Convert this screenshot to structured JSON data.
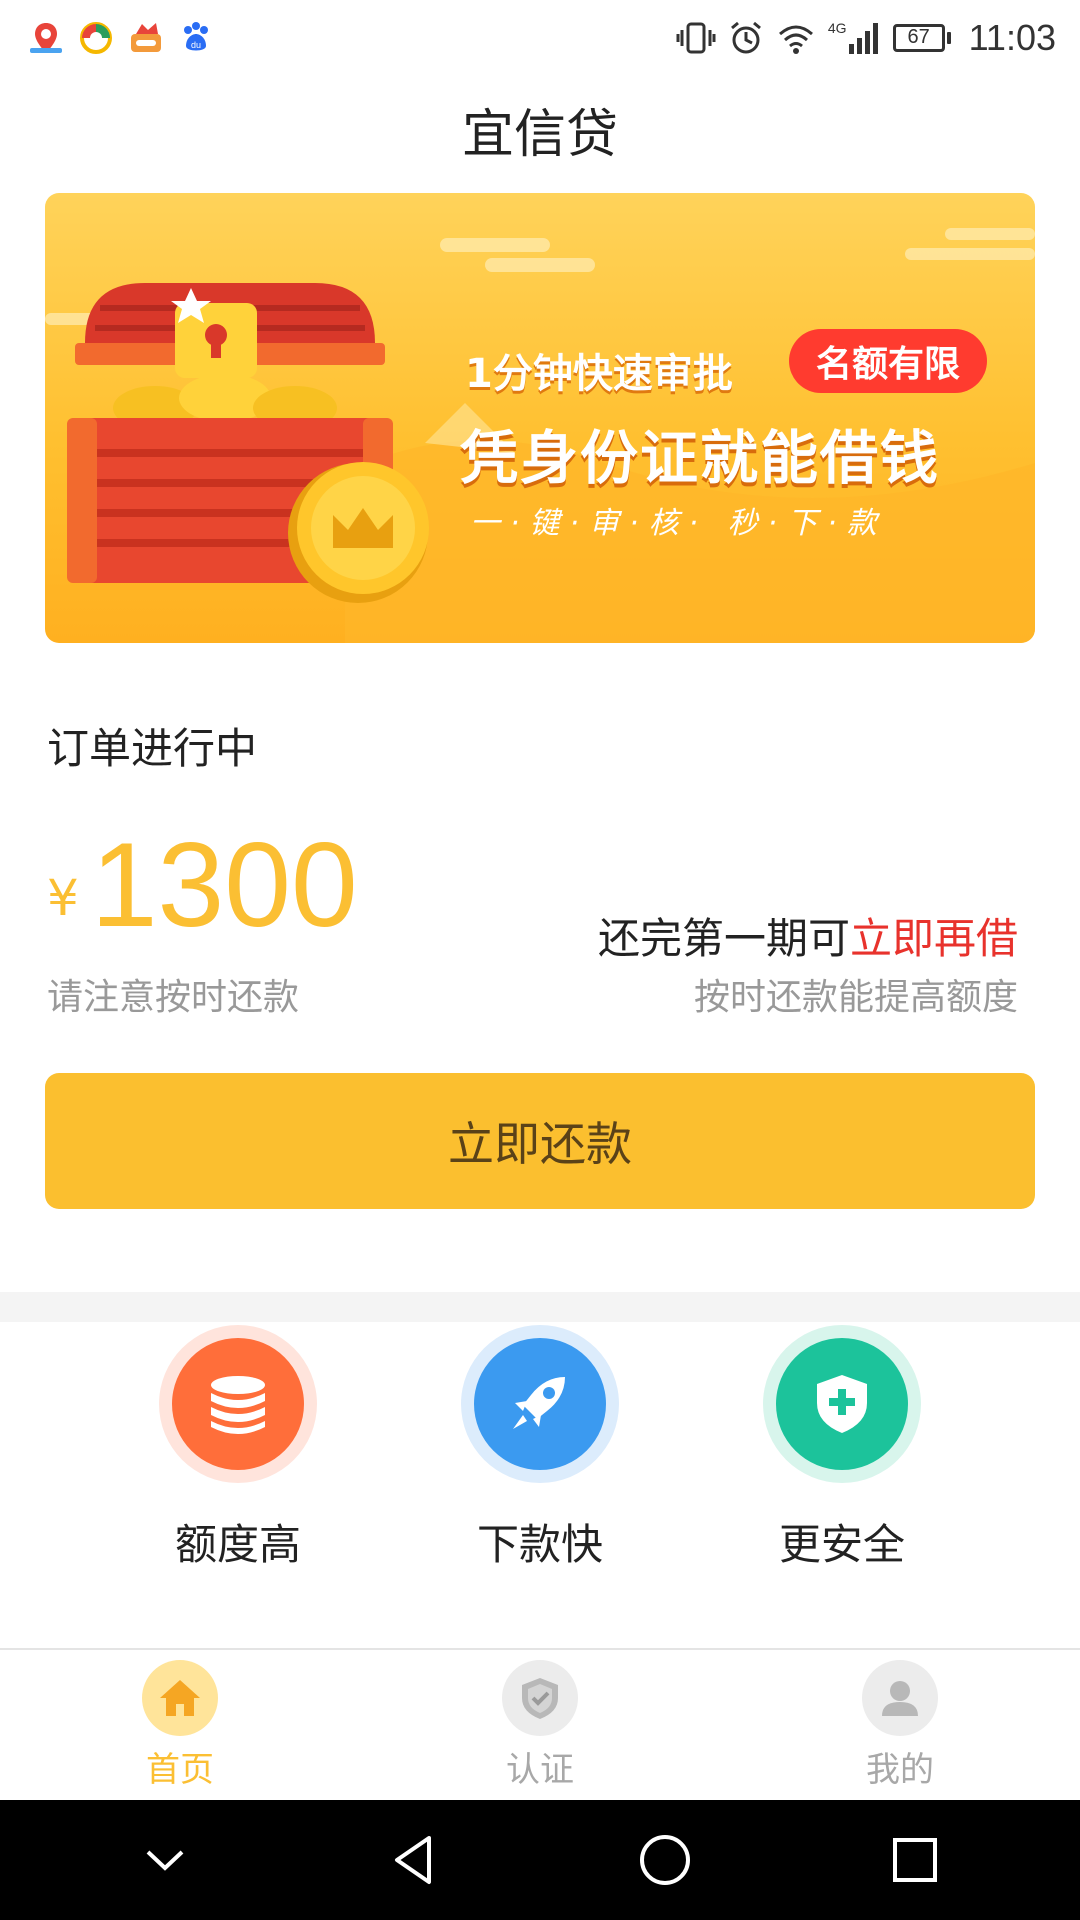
{
  "status_bar": {
    "time": "11:03",
    "battery": "67",
    "network": "4G",
    "notification_icons": [
      "map-icon",
      "browser-icon",
      "shop-icon",
      "baidu-icon"
    ]
  },
  "app": {
    "title": "宜信贷"
  },
  "banner": {
    "line1": "1分钟快速审批",
    "badge": "名额有限",
    "line2": "凭身份证就能借钱",
    "line3": "一·键·审·核· 秒·下·款"
  },
  "order": {
    "status": "订单进行中",
    "currency": "¥",
    "amount": "1300",
    "hint": "请注意按时还款",
    "reborrow_prefix": "还完第一期可",
    "reborrow_highlight": "立即再借",
    "raise_limit": "按时还款能提高额度"
  },
  "repay_button": {
    "label": "立即还款"
  },
  "features": [
    {
      "label": "额度高",
      "icon": "database-icon",
      "color": "#ff6e3a"
    },
    {
      "label": "下款快",
      "icon": "rocket-icon",
      "color": "#3b9af0"
    },
    {
      "label": "更安全",
      "icon": "shield-plus-icon",
      "color": "#1cc39b"
    }
  ],
  "nav": {
    "items": [
      {
        "label": "首页",
        "icon": "home-icon",
        "active": true
      },
      {
        "label": "认证",
        "icon": "shield-check-icon",
        "active": false
      },
      {
        "label": "我的",
        "icon": "user-icon",
        "active": false
      }
    ]
  },
  "colors": {
    "accent": "#fbbf33",
    "button": "#fbbf2f",
    "highlight_red": "#e8322c"
  }
}
